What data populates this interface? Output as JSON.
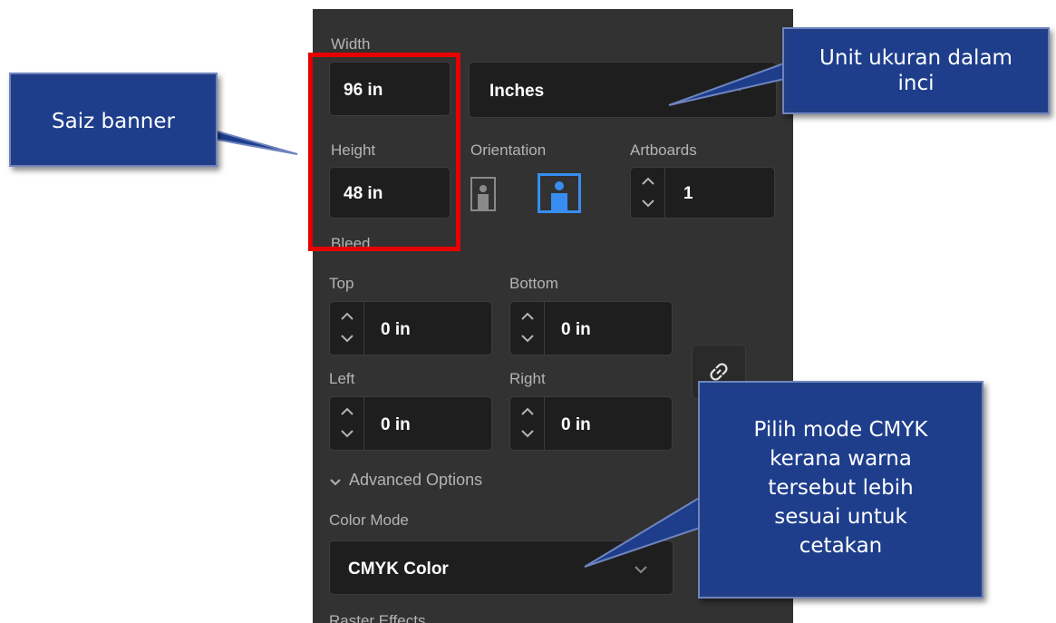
{
  "width": {
    "label": "Width",
    "value": "96 in"
  },
  "units": {
    "selected": "Inches"
  },
  "height": {
    "label": "Height",
    "value": "48 in"
  },
  "orientation": {
    "label": "Orientation",
    "active": "landscape"
  },
  "artboards": {
    "label": "Artboards",
    "value": "1"
  },
  "bleed": {
    "label": "Bleed",
    "top_label": "Top",
    "top_value": "0 in",
    "bottom_label": "Bottom",
    "bottom_value": "0 in",
    "left_label": "Left",
    "left_value": "0 in",
    "right_label": "Right",
    "right_value": "0 in"
  },
  "advanced": {
    "label": "Advanced Options"
  },
  "color_mode": {
    "label": "Color Mode",
    "selected": "CMYK Color"
  },
  "raster": {
    "label": "Raster Effects"
  },
  "callouts": {
    "size": "Saiz banner",
    "unit": "Unit ukuran dalam inci",
    "cmyk": "Pilih mode CMYK kerana warna tersebut lebih sesuai untuk cetakan"
  },
  "colors": {
    "panel_bg": "#323232",
    "field_bg": "#1e1e1e",
    "accent": "#378ef0",
    "highlight": "#e60000",
    "callout_bg": "#1e3e8c"
  }
}
